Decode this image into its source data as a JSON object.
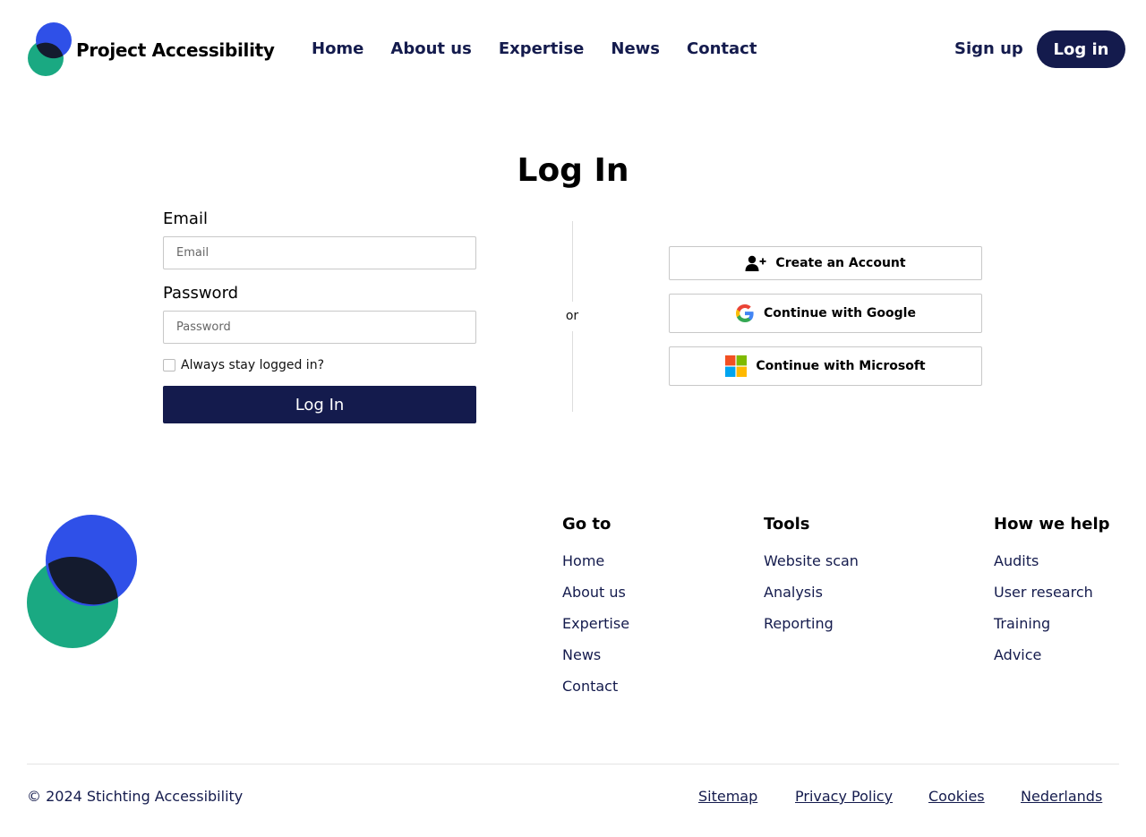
{
  "header": {
    "logo_text": "Project Accessibility",
    "nav": [
      "Home",
      "About us",
      "Expertise",
      "News",
      "Contact"
    ],
    "signup": "Sign up",
    "login": "Log in"
  },
  "main": {
    "title": "Log In",
    "email_label": "Email",
    "email_placeholder": "Email",
    "email_value": "",
    "password_label": "Password",
    "password_placeholder": "Password",
    "password_value": "",
    "remember_label": "Always stay logged in?",
    "remember_checked": false,
    "submit": "Log In",
    "or": "or",
    "create_account": "Create an Account",
    "google": "Continue with Google",
    "microsoft": "Continue with Microsoft"
  },
  "footer": {
    "columns": [
      {
        "heading": "Go to",
        "links": [
          "Home",
          "About us",
          "Expertise",
          "News",
          "Contact"
        ]
      },
      {
        "heading": "Tools",
        "links": [
          "Website scan",
          "Analysis",
          "Reporting"
        ]
      },
      {
        "heading": "How we help",
        "links": [
          "Audits",
          "User research",
          "Training",
          "Advice"
        ]
      }
    ],
    "copyright": "© 2024 Stichting Accessibility",
    "legal": [
      "Sitemap",
      "Privacy Policy",
      "Cookies",
      "Nederlands"
    ]
  },
  "colors": {
    "navy": "#141b4d",
    "logo_blue": "#2f50e8",
    "logo_green": "#1aa982",
    "logo_overlap": "#141b2e",
    "divider": "#dddddd",
    "input_border": "#c8c8c8"
  },
  "icons": {
    "create_account": "user-plus-icon",
    "google": "google-g-icon",
    "microsoft": "microsoft-logo-icon"
  }
}
